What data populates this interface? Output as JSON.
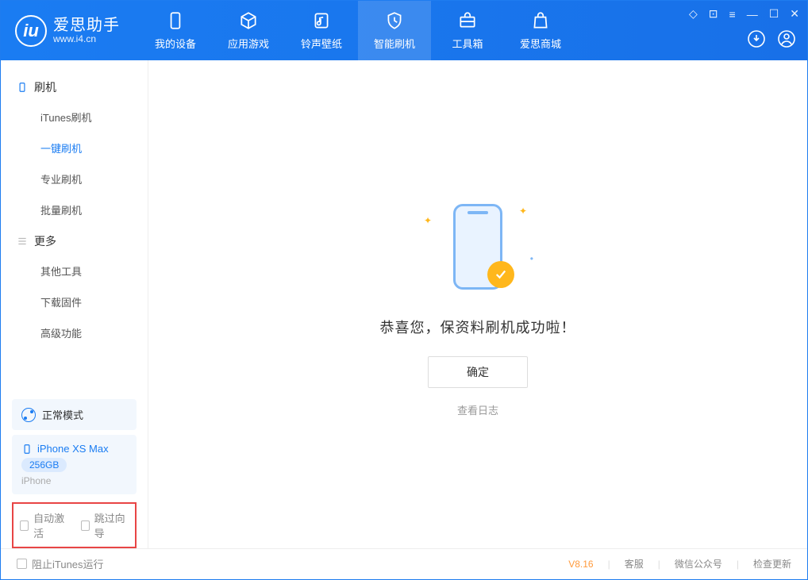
{
  "app": {
    "title": "爱思助手",
    "subtitle": "www.i4.cn"
  },
  "tabs": {
    "device": "我的设备",
    "apps": "应用游戏",
    "ringtone": "铃声壁纸",
    "flash": "智能刷机",
    "toolbox": "工具箱",
    "store": "爱思商城"
  },
  "sidebar": {
    "group_flash": "刷机",
    "items_flash": {
      "itunes": "iTunes刷机",
      "oneclick": "一键刷机",
      "pro": "专业刷机",
      "batch": "批量刷机"
    },
    "group_more": "更多",
    "items_more": {
      "tools": "其他工具",
      "firmware": "下载固件",
      "advanced": "高级功能"
    }
  },
  "mode": {
    "label": "正常模式"
  },
  "device": {
    "name": "iPhone XS Max",
    "storage": "256GB",
    "type": "iPhone"
  },
  "options": {
    "auto_activate": "自动激活",
    "skip_guide": "跳过向导"
  },
  "main": {
    "success": "恭喜您，保资料刷机成功啦！",
    "ok": "确定",
    "log": "查看日志"
  },
  "footer": {
    "block_itunes": "阻止iTunes运行",
    "version": "V8.16",
    "service": "客服",
    "wechat": "微信公众号",
    "update": "检查更新"
  }
}
